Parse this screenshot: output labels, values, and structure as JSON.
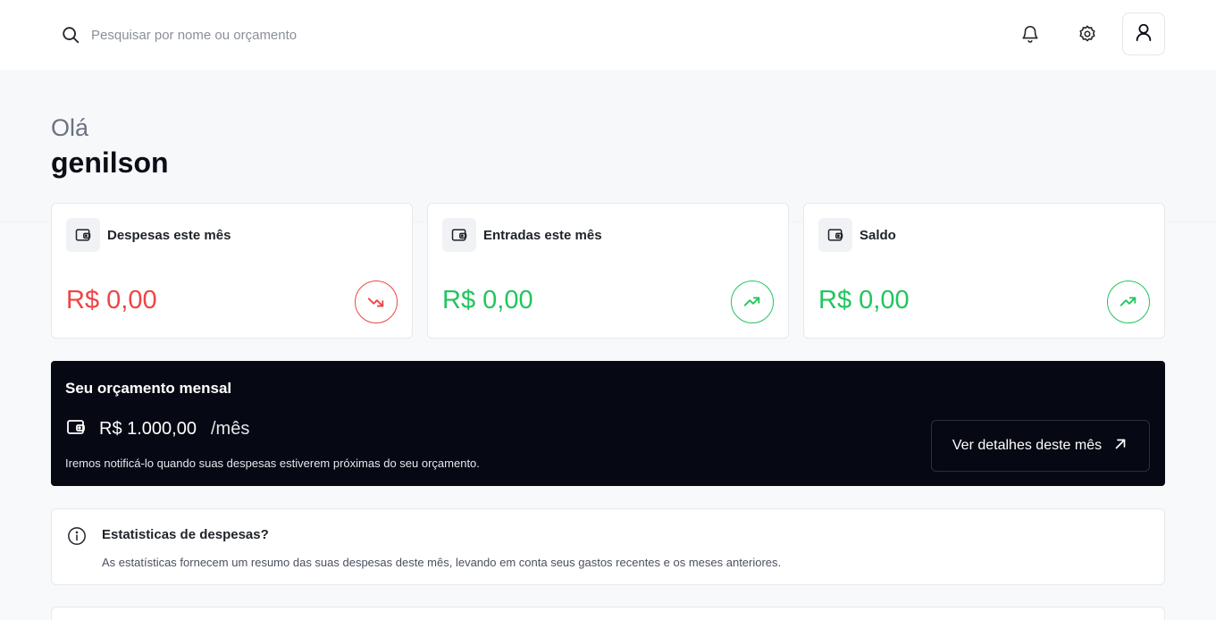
{
  "search": {
    "placeholder": "Pesquisar por nome ou orçamento",
    "icon": "search-icon"
  },
  "header": {
    "icons": [
      "bell-icon",
      "gear-icon",
      "user-icon"
    ]
  },
  "greeting": {
    "hello": "Olá",
    "name": "genilson"
  },
  "cards": [
    {
      "title": "Despesas este mês",
      "value": "R$ 0,00",
      "color": "#ef4444",
      "trend": "down"
    },
    {
      "title": "Entradas este mês",
      "value": "R$ 0,00",
      "color": "#22c55e",
      "trend": "up"
    },
    {
      "title": "Saldo",
      "value": "R$ 0,00",
      "color": "#22c55e",
      "trend": "up"
    }
  ],
  "budget": {
    "title": "Seu orçamento mensal",
    "amount": "R$ 1.000,00",
    "unit": "/mês",
    "note": "Iremos notificá-lo quando suas despesas estiverem próximas do seu orçamento.",
    "button_label": "Ver detalhes deste mês"
  },
  "stats": {
    "title": "Estatisticas de despesas?",
    "description": "As estatísticas fornecem um resumo das suas despesas deste mês, levando em conta seus gastos recentes e os meses anteriores."
  }
}
